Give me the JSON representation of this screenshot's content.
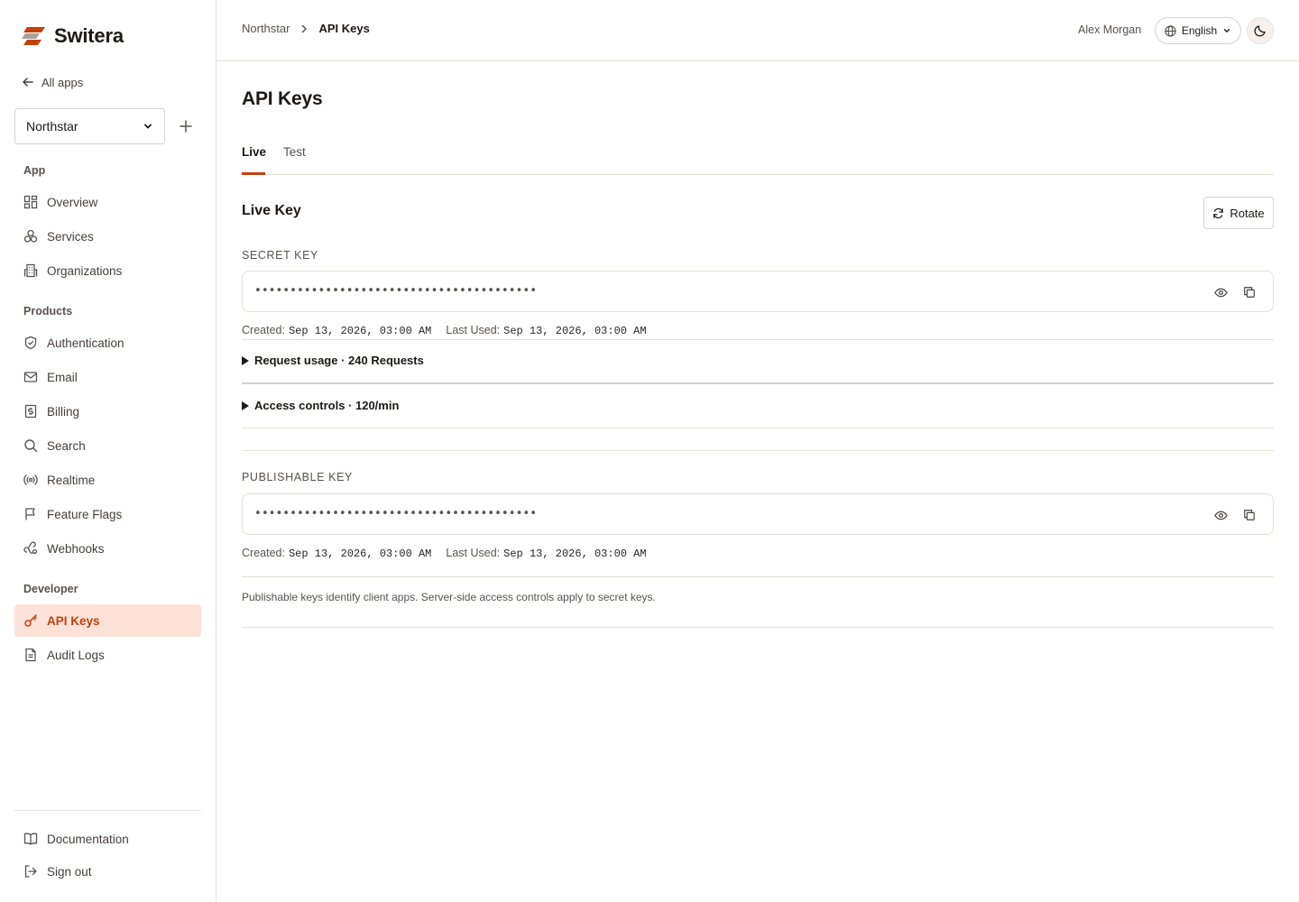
{
  "brand": {
    "name": "Switera",
    "accent": "#c2410c"
  },
  "sidebar": {
    "all_apps": "All apps",
    "app_select": {
      "value": "Northstar"
    },
    "sections": {
      "app": "App",
      "products": "Products",
      "developer": "Developer"
    },
    "app_items": [
      {
        "label": "Overview",
        "icon": "grid-icon"
      },
      {
        "label": "Services",
        "icon": "cubes-icon"
      },
      {
        "label": "Organizations",
        "icon": "building-icon"
      }
    ],
    "product_items": [
      {
        "label": "Authentication",
        "icon": "shield-icon"
      },
      {
        "label": "Email",
        "icon": "mail-icon"
      },
      {
        "label": "Billing",
        "icon": "dollar-icon"
      },
      {
        "label": "Search",
        "icon": "search-icon"
      },
      {
        "label": "Realtime",
        "icon": "broadcast-icon"
      },
      {
        "label": "Feature Flags",
        "icon": "flag-icon"
      },
      {
        "label": "Webhooks",
        "icon": "webhook-icon"
      }
    ],
    "developer_items": [
      {
        "label": "API Keys",
        "icon": "key-icon",
        "active": true
      },
      {
        "label": "Audit Logs",
        "icon": "file-icon"
      }
    ],
    "footer_items": [
      {
        "label": "Documentation",
        "icon": "book-icon"
      },
      {
        "label": "Sign out",
        "icon": "logout-icon"
      }
    ]
  },
  "header": {
    "breadcrumb": {
      "parent": "Northstar",
      "current": "API Keys"
    },
    "user": "Alex Morgan",
    "language": "English"
  },
  "main": {
    "title": "API Keys",
    "tabs": [
      {
        "label": "Live",
        "active": true
      },
      {
        "label": "Test"
      }
    ],
    "live_key": {
      "title": "Live Key",
      "rotate_label": "Rotate",
      "secret": {
        "label": "SECRET KEY",
        "masked": "••••••••••••••••••••••••••••••••••••••••",
        "created_label": "Created:",
        "created": "Sep 13, 2026, 03:00 AM",
        "last_used_label": "Last Used:",
        "last_used": "Sep 13, 2026, 03:00 AM"
      },
      "request_usage": "Request usage · 240 Requests",
      "access_controls": "Access controls · 120/min",
      "publishable": {
        "label": "PUBLISHABLE KEY",
        "masked": "••••••••••••••••••••••••••••••••••••••••",
        "created_label": "Created:",
        "created": "Sep 13, 2026, 03:00 AM",
        "last_used_label": "Last Used:",
        "last_used": "Sep 13, 2026, 03:00 AM"
      },
      "note": "Publishable keys identify client apps. Server-side access controls apply to secret keys."
    }
  }
}
